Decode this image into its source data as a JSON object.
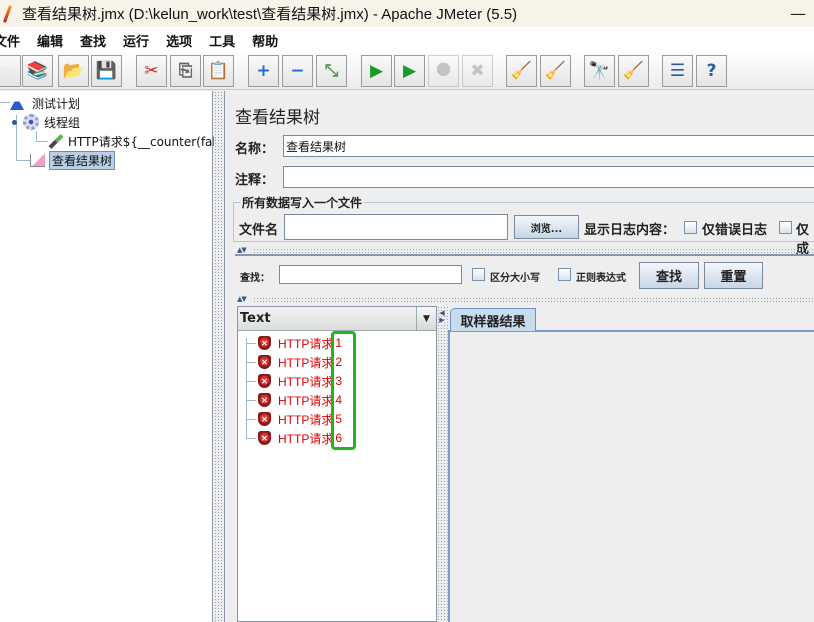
{
  "window": {
    "title": "查看结果树.jmx (D:\\kelun_work\\test\\查看结果树.jmx) - Apache JMeter (5.5)",
    "minimize_glyph": "—"
  },
  "menu": [
    "文件",
    "编辑",
    "查找",
    "运行",
    "选项",
    "工具",
    "帮助"
  ],
  "toolbar": [
    {
      "name": "new-icon",
      "glyph": "▭",
      "color": "#e8e8e8"
    },
    {
      "name": "templates-icon",
      "glyph": "📚",
      "color": "#2a7a2a"
    },
    {
      "name": "open-icon",
      "glyph": "📂",
      "color": "#d09a20"
    },
    {
      "name": "save-icon",
      "glyph": "💾",
      "color": "#333"
    },
    {
      "name": "cut-icon",
      "glyph": "✂",
      "color": "#d02020"
    },
    {
      "name": "copy-icon",
      "glyph": "⎘",
      "color": "#666"
    },
    {
      "name": "paste-icon",
      "glyph": "📋",
      "color": "#8a5a20"
    },
    {
      "name": "expand-icon",
      "glyph": "+",
      "color": "#2a6ad0"
    },
    {
      "name": "collapse-icon",
      "glyph": "−",
      "color": "#2a6ad0"
    },
    {
      "name": "toggle-icon",
      "glyph": "⤡",
      "color": "#5a9a5a"
    },
    {
      "name": "start-icon",
      "glyph": "▶",
      "color": "#1a9a2a"
    },
    {
      "name": "start-no-pause-icon",
      "glyph": "▶",
      "color": "#1a9a2a"
    },
    {
      "name": "stop-icon",
      "glyph": "⯃",
      "color": "#888",
      "disabled": true
    },
    {
      "name": "shutdown-icon",
      "glyph": "✖",
      "color": "#888",
      "disabled": true
    },
    {
      "name": "clear-icon",
      "glyph": "🧹",
      "color": "#a07a40"
    },
    {
      "name": "clear-all-icon",
      "glyph": "🧹",
      "color": "#a07a40"
    },
    {
      "name": "search-icon",
      "glyph": "🔭",
      "color": "#222"
    },
    {
      "name": "reset-search-icon",
      "glyph": "🧹",
      "color": "#e0b020"
    },
    {
      "name": "function-helper-icon",
      "glyph": "☰",
      "color": "#2a5aa0"
    },
    {
      "name": "help-icon",
      "glyph": "?",
      "color": "#2a5aa0"
    }
  ],
  "tree": {
    "items": [
      {
        "label": "测试计划",
        "icon": "flask-icon"
      },
      {
        "label": "线程组",
        "icon": "gear-icon"
      },
      {
        "label": "HTTP请求${__counter(fals",
        "icon": "pipette-icon"
      },
      {
        "label": "查看结果树",
        "icon": "chart-icon",
        "selected": true
      }
    ]
  },
  "panel": {
    "heading": "查看结果树",
    "name_label": "名称：",
    "name_value": "查看结果树",
    "comment_label": "注释：",
    "comment_value": "",
    "file_group_title": "所有数据写入一个文件",
    "filename_label": "文件名",
    "filename_value": "",
    "browse_label": "浏览...",
    "log_display_label": "显示日志内容：",
    "errors_only_label": "仅错误日志",
    "success_only_label": "仅成",
    "search_label": "查找：",
    "search_value": "",
    "case_sensitive_label": "区分大小写",
    "regex_label": "正则表达式",
    "find_button": "查找",
    "reset_button": "重置",
    "renderer_selected": "Text",
    "tab_label": "取样器结果"
  },
  "results": [
    {
      "label": "HTTP请求",
      "num": "1",
      "status": "error"
    },
    {
      "label": "HTTP请求",
      "num": "2",
      "status": "error"
    },
    {
      "label": "HTTP请求",
      "num": "3",
      "status": "error"
    },
    {
      "label": "HTTP请求",
      "num": "4",
      "status": "error"
    },
    {
      "label": "HTTP请求",
      "num": "5",
      "status": "error"
    },
    {
      "label": "HTTP请求",
      "num": "6",
      "status": "error"
    }
  ],
  "colors": {
    "error_text": "#e00000",
    "highlight": "#22b422",
    "selection": "#b8cfe5"
  }
}
